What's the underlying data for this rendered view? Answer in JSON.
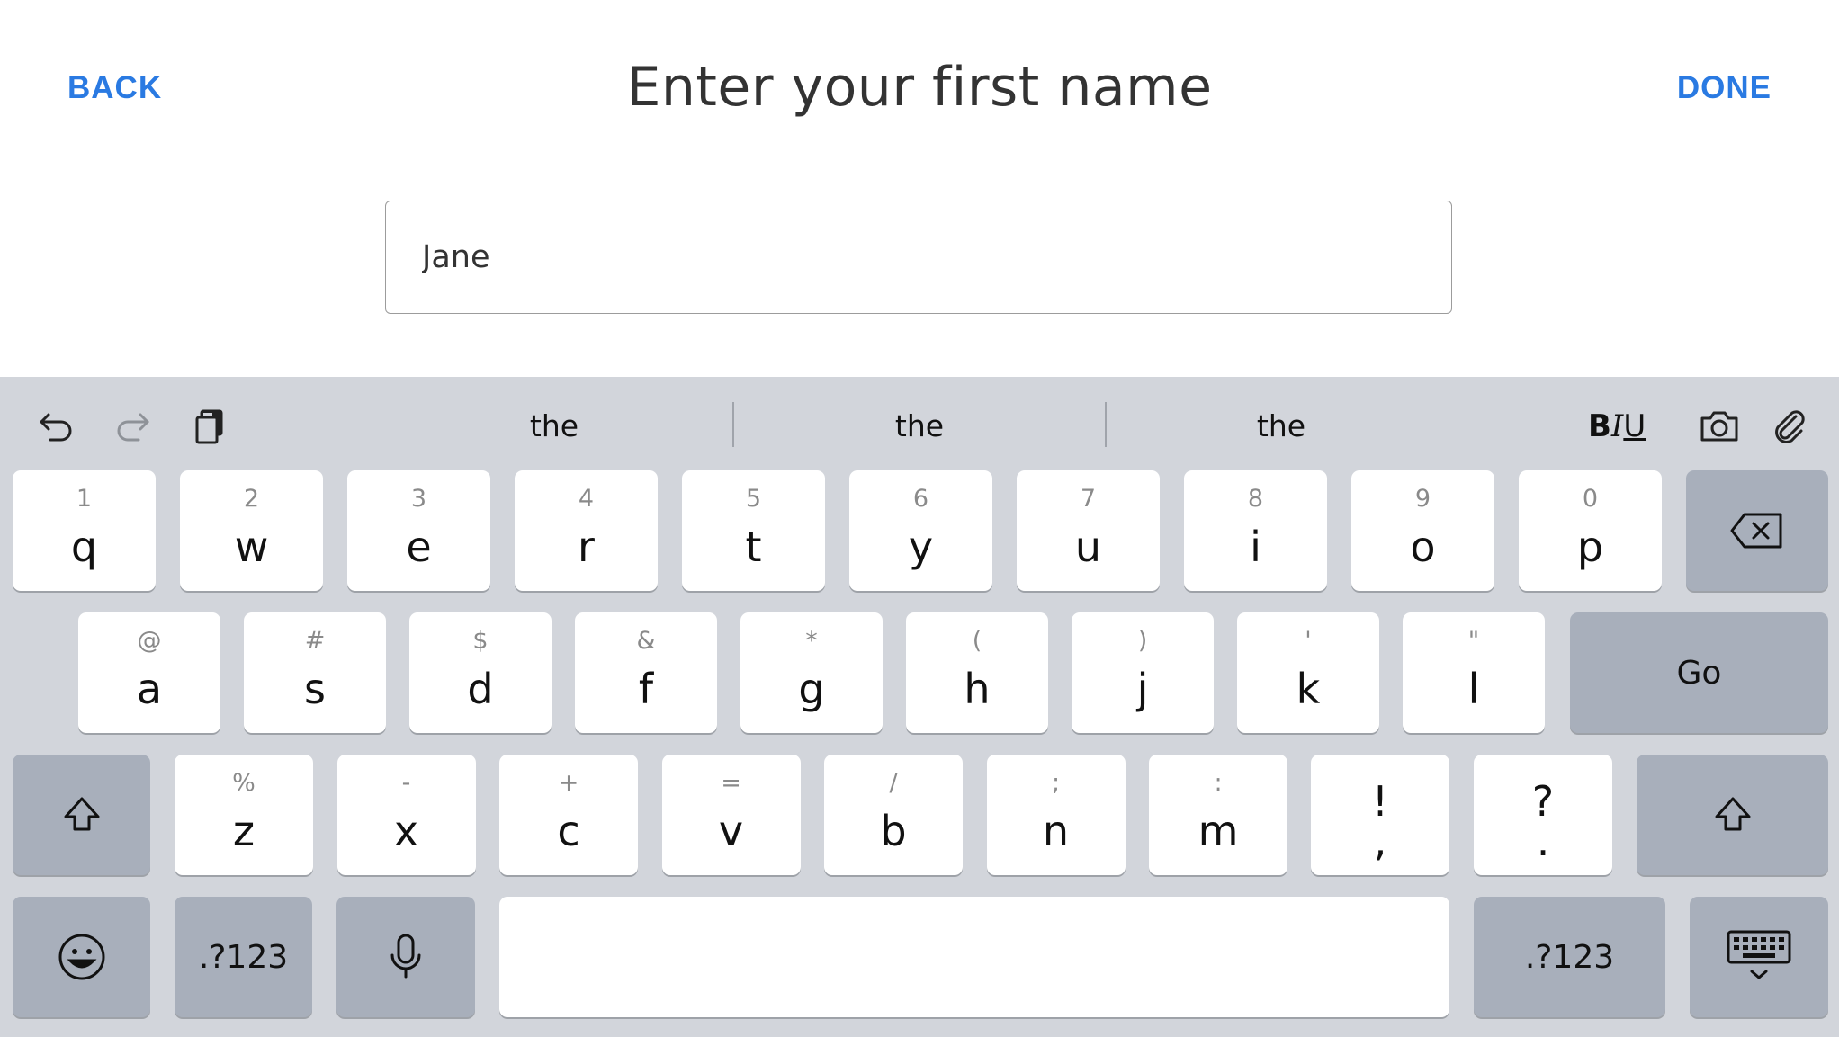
{
  "header": {
    "back_label": "BACK",
    "title": "Enter your first name",
    "done_label": "DONE"
  },
  "form": {
    "first_name_value": "Jane"
  },
  "keyboard": {
    "toolbar": {
      "suggestions": [
        "the",
        "the",
        "the"
      ],
      "format_bold": "B",
      "format_italic": "I",
      "format_underline": "U"
    },
    "row1": [
      {
        "sec": "1",
        "pri": "q"
      },
      {
        "sec": "2",
        "pri": "w"
      },
      {
        "sec": "3",
        "pri": "e"
      },
      {
        "sec": "4",
        "pri": "r"
      },
      {
        "sec": "5",
        "pri": "t"
      },
      {
        "sec": "6",
        "pri": "y"
      },
      {
        "sec": "7",
        "pri": "u"
      },
      {
        "sec": "8",
        "pri": "i"
      },
      {
        "sec": "9",
        "pri": "o"
      },
      {
        "sec": "0",
        "pri": "p"
      }
    ],
    "row2": [
      {
        "sec": "@",
        "pri": "a"
      },
      {
        "sec": "#",
        "pri": "s"
      },
      {
        "sec": "$",
        "pri": "d"
      },
      {
        "sec": "&",
        "pri": "f"
      },
      {
        "sec": "*",
        "pri": "g"
      },
      {
        "sec": "(",
        "pri": "h"
      },
      {
        "sec": ")",
        "pri": "j"
      },
      {
        "sec": "'",
        "pri": "k"
      },
      {
        "sec": "\"",
        "pri": "l"
      }
    ],
    "go_label": "Go",
    "row3": [
      {
        "sec": "%",
        "pri": "z"
      },
      {
        "sec": "-",
        "pri": "x"
      },
      {
        "sec": "+",
        "pri": "c"
      },
      {
        "sec": "=",
        "pri": "v"
      },
      {
        "sec": "/",
        "pri": "b"
      },
      {
        "sec": ";",
        "pri": "n"
      },
      {
        "sec": ":",
        "pri": "m"
      }
    ],
    "punct_keys": [
      {
        "top": "!",
        "bottom": ","
      },
      {
        "top": "?",
        "bottom": "."
      }
    ],
    "numbers_label_left": ".?123",
    "numbers_label_right": ".?123",
    "icons": {
      "undo": "undo-icon",
      "redo": "redo-icon",
      "clipboard": "clipboard-icon",
      "camera": "camera-icon",
      "attach": "paperclip-icon",
      "backspace": "backspace-icon",
      "shift": "shift-icon",
      "emoji": "emoji-icon",
      "mic": "microphone-icon",
      "hide_keyboard": "hide-keyboard-icon"
    },
    "colors": {
      "background": "#d2d5db",
      "key": "#ffffff",
      "function_key": "#a8afbb",
      "accent": "#2a7ae2"
    }
  }
}
